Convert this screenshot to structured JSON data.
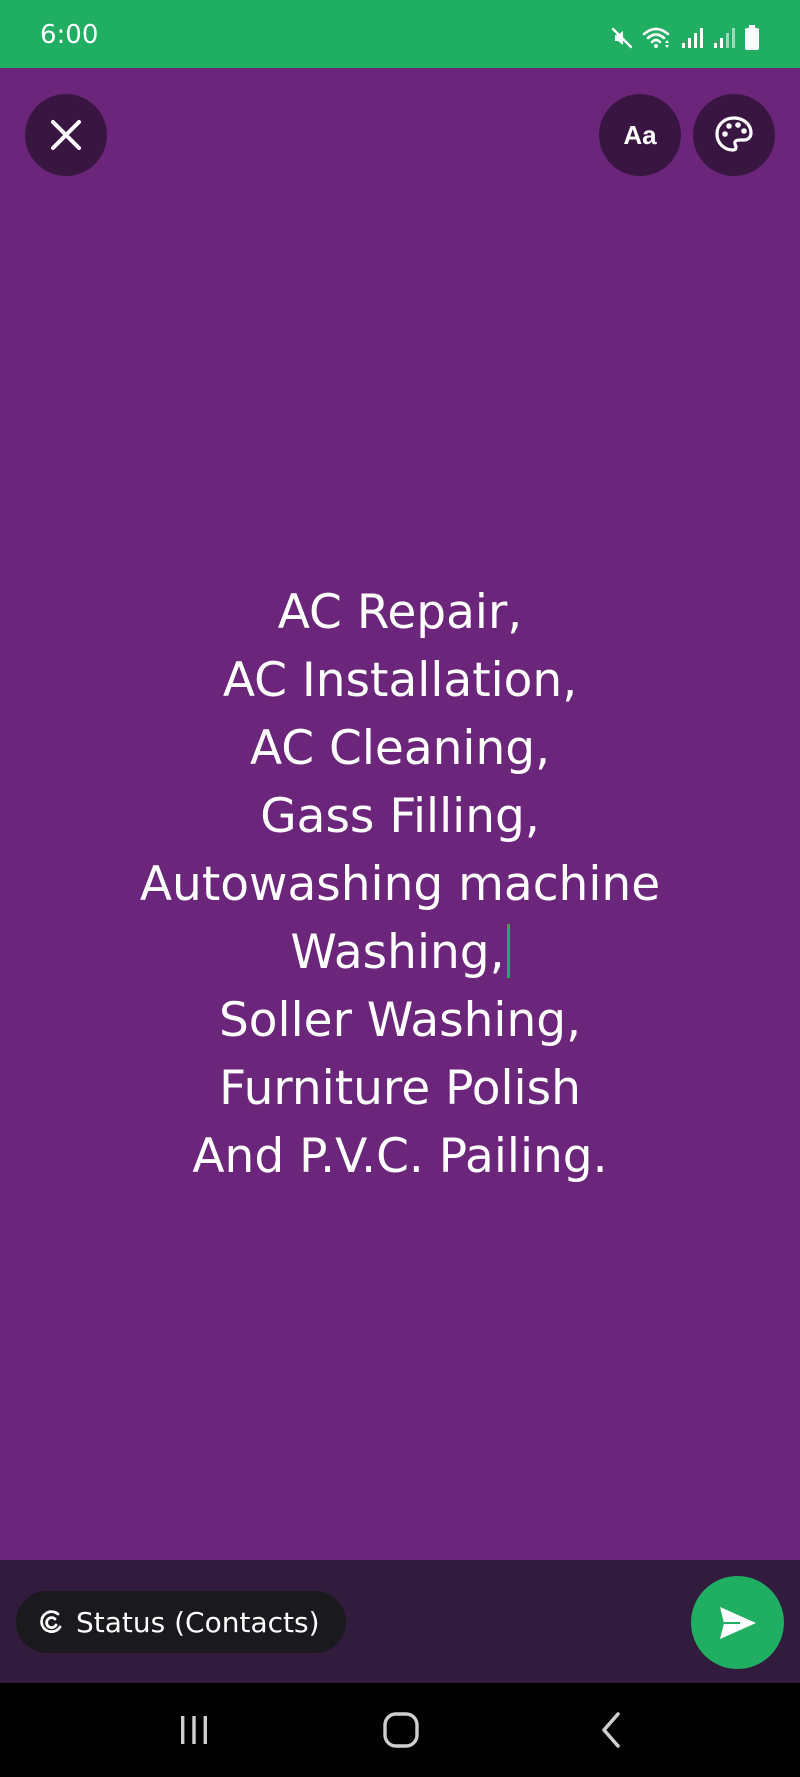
{
  "status_bar": {
    "time": "6:00",
    "icons": [
      "mute-icon",
      "wifi-icon",
      "signal-icon",
      "signal-icon-2",
      "battery-icon"
    ],
    "color": "#20ae62"
  },
  "composer": {
    "background_color": "#6b267b",
    "close_icon": "close-icon",
    "font_button_label": "Aa",
    "color_palette_icon": "palette-icon",
    "text_lines": [
      "AC Repair,",
      "AC Installation,",
      "AC Cleaning,",
      "Gass Filling,",
      "Autowashing machine",
      "Washing,",
      "Soller Washing,",
      "Furniture Polish",
      "And P.V.C. Pailing."
    ]
  },
  "bottom_bar": {
    "audience_icon": "status-privacy-icon",
    "audience_label": "Status (Contacts)",
    "send_icon": "send-icon",
    "accent_color": "#20ae62"
  },
  "nav_bar": {
    "icons": [
      "recent-apps-icon",
      "home-icon",
      "back-icon"
    ]
  }
}
